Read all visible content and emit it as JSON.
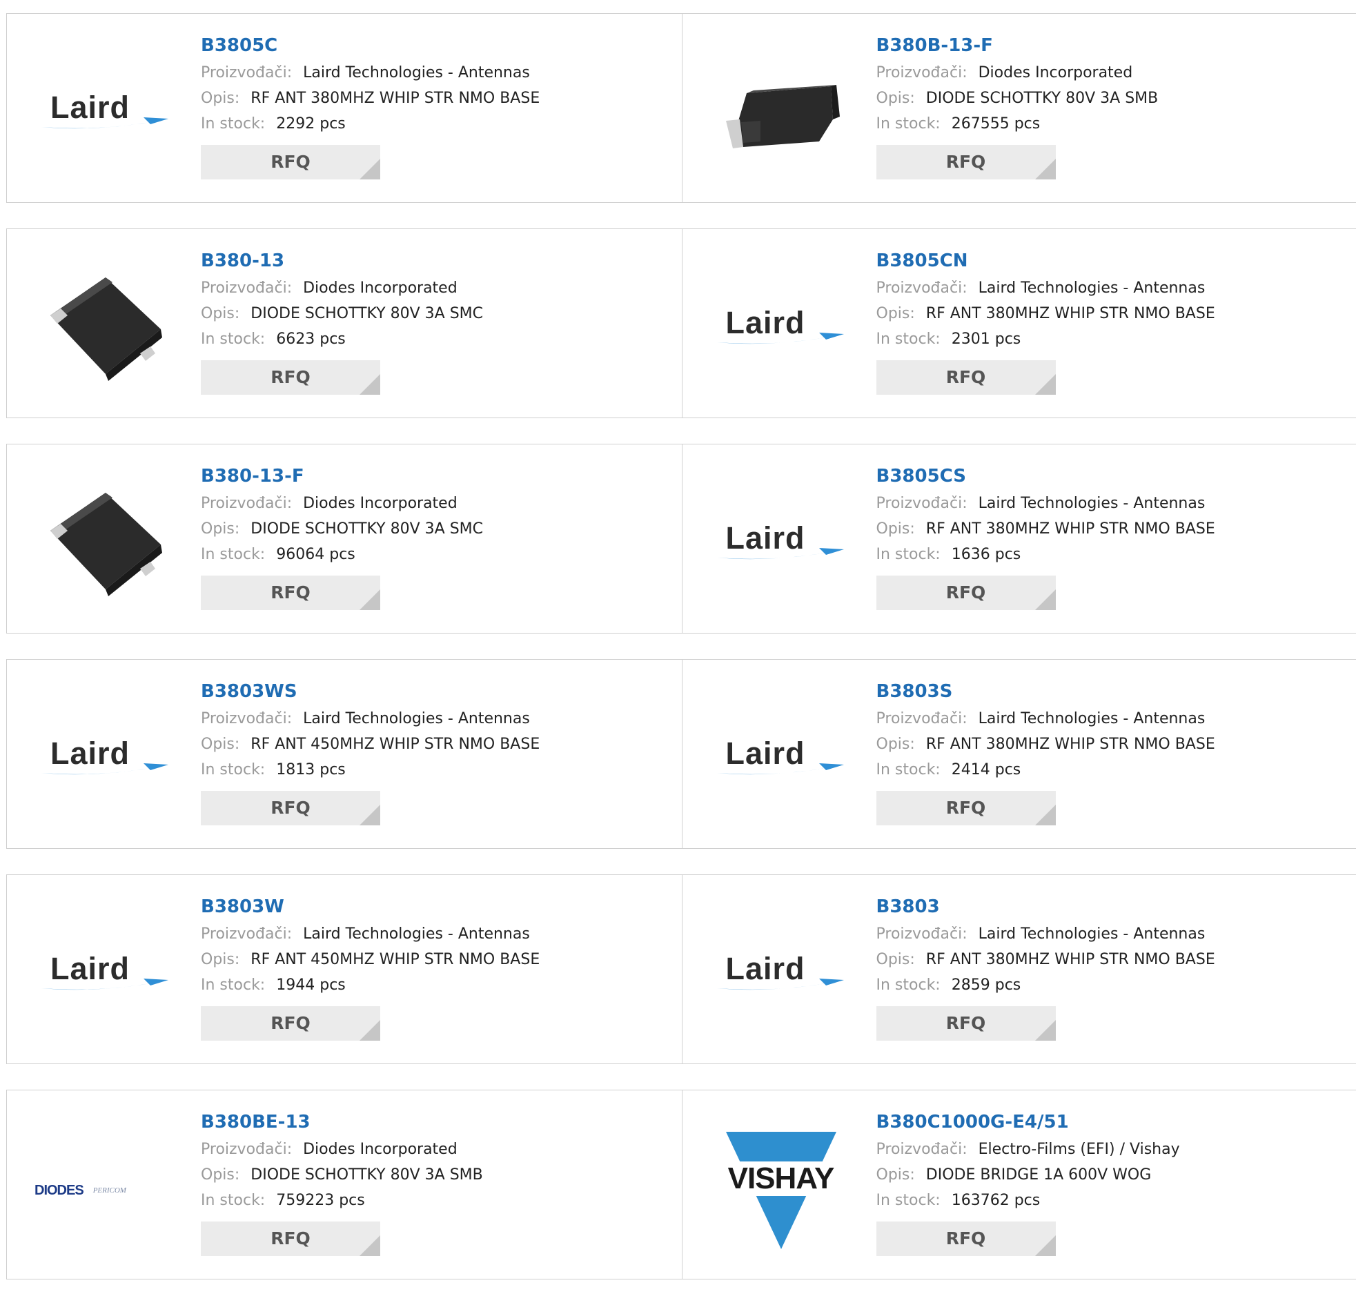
{
  "labels": {
    "manufacturer": "Proizvođači:",
    "description": "Opis:",
    "stock": "In stock:",
    "rfq": "RFQ",
    "pcs": "pcs"
  },
  "logos": {
    "laird": "Laird",
    "diodes": "DIODES",
    "pericom": "PERICOM",
    "vishay": "VISHAY"
  },
  "colors": {
    "part_link": "#1f6cb3",
    "laird_swoosh": "#2f8fd6",
    "vishay_blue": "#2e8fcf",
    "rfq_bg": "#ebebeb"
  },
  "products": [
    {
      "part": "B3805C",
      "manufacturer": "Laird Technologies - Antennas",
      "description": "RF ANT 380MHZ WHIP STR NMO BASE",
      "stock": "2292",
      "image": "laird-logo"
    },
    {
      "part": "B380B-13-F",
      "manufacturer": "Diodes Incorporated",
      "description": "DIODE SCHOTTKY 80V 3A SMB",
      "stock": "267555",
      "image": "smb-package"
    },
    {
      "part": "B380-13",
      "manufacturer": "Diodes Incorporated",
      "description": "DIODE SCHOTTKY 80V 3A SMC",
      "stock": "6623",
      "image": "smc-package"
    },
    {
      "part": "B3805CN",
      "manufacturer": "Laird Technologies - Antennas",
      "description": "RF ANT 380MHZ WHIP STR NMO BASE",
      "stock": "2301",
      "image": "laird-logo"
    },
    {
      "part": "B380-13-F",
      "manufacturer": "Diodes Incorporated",
      "description": "DIODE SCHOTTKY 80V 3A SMC",
      "stock": "96064",
      "image": "smc-package"
    },
    {
      "part": "B3805CS",
      "manufacturer": "Laird Technologies - Antennas",
      "description": "RF ANT 380MHZ WHIP STR NMO BASE",
      "stock": "1636",
      "image": "laird-logo"
    },
    {
      "part": "B3803WS",
      "manufacturer": "Laird Technologies - Antennas",
      "description": "RF ANT 450MHZ WHIP STR NMO BASE",
      "stock": "1813",
      "image": "laird-logo"
    },
    {
      "part": "B3803S",
      "manufacturer": "Laird Technologies - Antennas",
      "description": "RF ANT 380MHZ WHIP STR NMO BASE",
      "stock": "2414",
      "image": "laird-logo"
    },
    {
      "part": "B3803W",
      "manufacturer": "Laird Technologies - Antennas",
      "description": "RF ANT 450MHZ WHIP STR NMO BASE",
      "stock": "1944",
      "image": "laird-logo"
    },
    {
      "part": "B3803",
      "manufacturer": "Laird Technologies - Antennas",
      "description": "RF ANT 380MHZ WHIP STR NMO BASE",
      "stock": "2859",
      "image": "laird-logo"
    },
    {
      "part": "B380BE-13",
      "manufacturer": "Diodes Incorporated",
      "description": "DIODE SCHOTTKY 80V 3A SMB",
      "stock": "759223",
      "image": "diodes-logo"
    },
    {
      "part": "B380C1000G-E4/51",
      "manufacturer": "Electro-Films (EFI) / Vishay",
      "description": "DIODE BRIDGE 1A 600V WOG",
      "stock": "163762",
      "image": "vishay-logo"
    }
  ]
}
